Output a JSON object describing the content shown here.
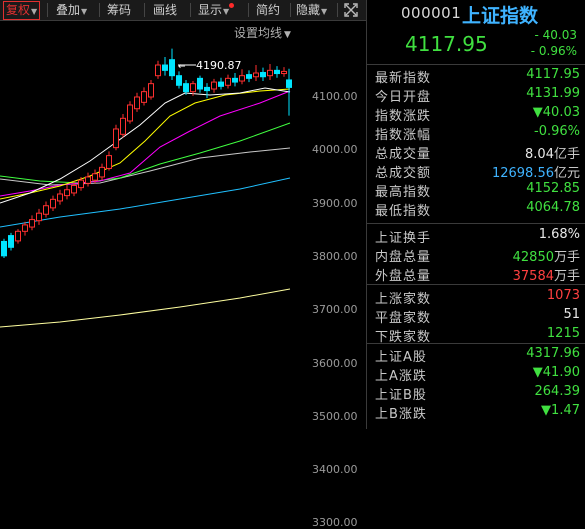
{
  "toolbar": {
    "items": [
      {
        "label": "复权",
        "arrow": true
      },
      {
        "label": "叠加",
        "arrow": true
      },
      {
        "label": "筹码",
        "arrow": false
      },
      {
        "label": "画线",
        "arrow": false
      },
      {
        "label": "显示",
        "arrow": true
      },
      {
        "label": "简约",
        "arrow": false
      },
      {
        "label": "隐藏",
        "arrow": true
      }
    ],
    "expand_icon": "expand-icon"
  },
  "chart": {
    "ma_settings_label": "设置均线",
    "high_annotation": "4190.87",
    "y_axis_labels": [
      "4100.00",
      "4000.00",
      "3900.00",
      "3800.00",
      "3700.00",
      "3600.00",
      "3500.00",
      "3400.00",
      "3300.00"
    ],
    "colors": {
      "up": "#ff3030",
      "down": "#00e5ff",
      "ma5": "#ffffff",
      "ma10": "#ffff00",
      "ma20": "#ff00ff",
      "ma30": "#40ff40",
      "ma60": "#c8c8c8",
      "ma120": "#20c0ff",
      "ma250": "#ffffa0"
    }
  },
  "quote": {
    "code": "000001",
    "name": "上证指数",
    "price": "4117.95",
    "change": "- 40.03",
    "change_pct": "- 0.96%"
  },
  "stats": [
    {
      "label": "最新指数",
      "value": "4117.95",
      "color": "g"
    },
    {
      "label": "今日开盘",
      "value": "4131.99",
      "color": "g"
    },
    {
      "label": "指数涨跌",
      "value": "▼40.03",
      "color": "g"
    },
    {
      "label": "指数涨幅",
      "value": "-0.96%",
      "color": "g"
    },
    {
      "label": "总成交量",
      "value": "8.04",
      "unit": "亿手",
      "color": "w"
    },
    {
      "label": "总成交额",
      "value": "12698.56",
      "unit": "亿元",
      "color": "b"
    },
    {
      "label": "最高指数",
      "value": "4152.85",
      "color": "g"
    },
    {
      "label": "最低指数",
      "value": "4064.78",
      "color": "g"
    },
    {
      "label": "上证换手",
      "value": "1.68%",
      "color": "w"
    },
    {
      "label": "内盘总量",
      "value": "42850",
      "unit": "万手",
      "color": "g"
    },
    {
      "label": "外盘总量",
      "value": "37584",
      "unit": "万手",
      "color": "r"
    },
    {
      "label": "上涨家数",
      "value": "1073",
      "color": "r"
    },
    {
      "label": "平盘家数",
      "value": "51",
      "color": "w"
    },
    {
      "label": "下跌家数",
      "value": "1215",
      "color": "g"
    },
    {
      "label": "上证A股",
      "value": "4317.96",
      "color": "g"
    },
    {
      "label": "上A涨跌",
      "value": "▼41.90",
      "color": "g"
    },
    {
      "label": "上证B股",
      "value": "264.39",
      "color": "g"
    },
    {
      "label": "上B涨跌",
      "value": "▼1.47",
      "color": "g"
    }
  ]
}
